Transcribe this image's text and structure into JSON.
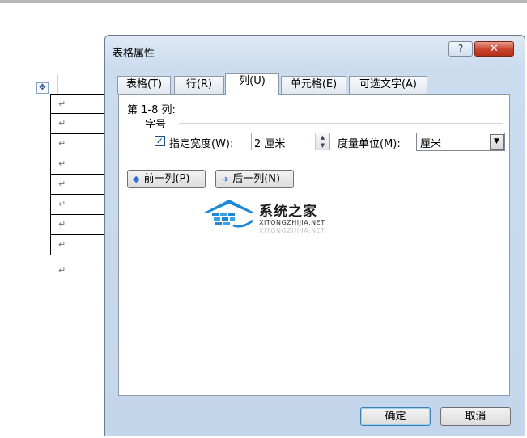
{
  "document": {
    "move_handle": "✥",
    "row_mark": "↵",
    "row_count": 8
  },
  "dialog": {
    "title": "表格属性",
    "help_label": "?",
    "close_label": "✕",
    "tabs": [
      {
        "label": "表格(T)",
        "active": false
      },
      {
        "label": "行(R)",
        "active": false
      },
      {
        "label": "列(U)",
        "active": true
      },
      {
        "label": "单元格(E)",
        "active": false
      },
      {
        "label": "可选文字(A)",
        "active": false
      }
    ],
    "column_range": "第 1-8 列:",
    "section_label": "字号",
    "width_checkbox": {
      "label": "指定宽度(W):",
      "checked": true,
      "mark": "✓"
    },
    "width_value": "2 厘米",
    "unit_label": "度量单位(M):",
    "unit_value": "厘米",
    "prev_column": "前一列(P)",
    "next_column": "后一列(N)",
    "ok_label": "确定",
    "cancel_label": "取消"
  },
  "watermark": {
    "title": "系统之家",
    "subtitle": "XITONGZHIJIA.NET"
  },
  "colors": {
    "accent": "#2f6ed5",
    "close_red": "#c8432b",
    "watermark_blue": "#1e88d8"
  }
}
